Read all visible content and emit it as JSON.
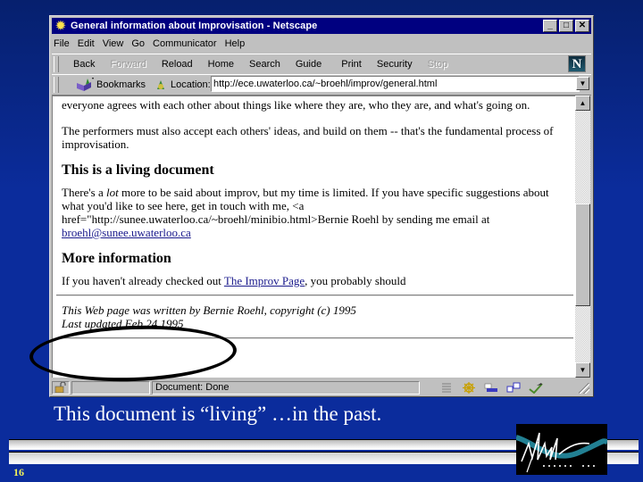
{
  "window": {
    "title": "General information about Improvisation - Netscape",
    "controls": {
      "minimize": "_",
      "maximize": "□",
      "close": "✕"
    }
  },
  "menu": [
    {
      "label": "File",
      "accel": "F"
    },
    {
      "label": "Edit",
      "accel": "E"
    },
    {
      "label": "View",
      "accel": "V"
    },
    {
      "label": "Go",
      "accel": "G"
    },
    {
      "label": "Communicator",
      "accel": "C"
    },
    {
      "label": "Help",
      "accel": "H"
    }
  ],
  "toolbar": {
    "back": "Back",
    "forward": "Forward",
    "reload": "Reload",
    "home": "Home",
    "search": "Search",
    "guide": "Guide",
    "print": "Print",
    "security": "Security",
    "stop": "Stop",
    "logo": "N"
  },
  "location_bar": {
    "bookmarks_label": "Bookmarks",
    "location_label": "Location:",
    "url": "http://ece.uwaterloo.ca/~broehl/improv/general.html"
  },
  "content": {
    "para1": "everyone agrees with each other about things like where they are, who they are, and what's going on.",
    "para2": "The performers must also accept each others' ideas, and build on them -- that's the fundamental process of improvisation.",
    "heading1": "This is a living document",
    "para3_pre": "There's a ",
    "para3_em": "lot",
    "para3_post": " more to be said about improv, but my time is limited. If you have specific suggestions about what you'd like to see here, get in touch with me, <a href=\"http://sunee.uwaterloo.ca/~broehl/minibio.html>Bernie Roehl by sending me email at ",
    "email_link": "broehl@sunee.uwaterloo.ca",
    "heading2": "More information",
    "para4_pre": "If you haven't already checked out ",
    "improv_link": "The Improv Page",
    "para4_post": ", you probably should",
    "footer_line1": "This Web page was written by Bernie Roehl, copyright (c) 1995",
    "footer_line2": "Last updated Feb 24 1995"
  },
  "scroll": {
    "position_fraction": 0.62
  },
  "status": {
    "text": "Document: Done"
  },
  "slide": {
    "caption": "This document is “living” …in the past.",
    "page_number": "16"
  },
  "colors": {
    "slide_background": "#0b2c9c",
    "title_bar": "#000080",
    "link": "#1a1a8c",
    "page_number": "#f0f05a"
  }
}
